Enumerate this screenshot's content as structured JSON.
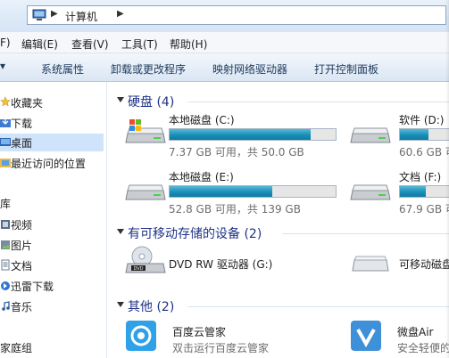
{
  "address": {
    "crumb": "计算机",
    "icon": "computer-icon"
  },
  "menu": [
    "F)",
    "编辑(E)",
    "查看(V)",
    "工具(T)",
    "帮助(H)"
  ],
  "toolbar": [
    "系统属性",
    "卸载或更改程序",
    "映射网络驱动器",
    "打开控制面板"
  ],
  "nav": {
    "favorites": "收藏夹",
    "downloads": "下载",
    "desktop": "桌面",
    "recent": "最近访问的位置",
    "libraries": "库",
    "videos": "视频",
    "pictures": "图片",
    "documents": "文档",
    "xunlei": "迅雷下载",
    "music": "音乐",
    "homegroup": "家庭组"
  },
  "groups": {
    "hdd": "硬盘 (4)",
    "removable": "有可移动存储的设备 (2)",
    "other": "其他 (2)"
  },
  "drives": [
    {
      "name": "本地磁盘 (C:)",
      "free": "7.37 GB 可用，共 50.0 GB",
      "used_fraction": 0.85
    },
    {
      "name": "软件 (D:)",
      "free": "60.6 GB 可",
      "used_fraction": 0.55
    },
    {
      "name": "本地磁盘 (E:)",
      "free": "52.8 GB 可用，共 139 GB",
      "used_fraction": 0.62
    },
    {
      "name": "文档 (F:)",
      "free": "67.9 GB 可",
      "used_fraction": 0.5
    }
  ],
  "removable": [
    {
      "name": "DVD RW 驱动器 (G:)"
    },
    {
      "name": "可移动磁盘"
    }
  ],
  "other": [
    {
      "name": "百度云管家",
      "sub": "双击运行百度云管家"
    },
    {
      "name": "微盘Air",
      "sub": "安全轻便的"
    }
  ],
  "colors": {
    "bar": "#1a8fb8",
    "group_text": "#1e3287",
    "selection": "#cfe3fb"
  }
}
